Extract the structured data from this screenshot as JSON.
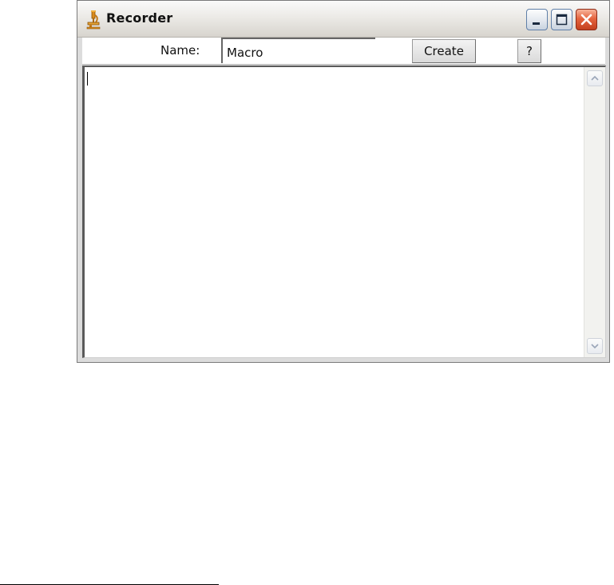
{
  "window": {
    "title": "Recorder",
    "app_icon": "microscope-icon",
    "controls": {
      "minimize_icon": "minimize-icon",
      "maximize_icon": "maximize-icon",
      "close_icon": "close-icon"
    }
  },
  "toolbar": {
    "name_label": "Name:",
    "name_value": "Macro",
    "create_label": "Create",
    "help_label": "?"
  },
  "editor": {
    "content": "",
    "scroll_up_icon": "chevron-up-icon",
    "scroll_down_icon": "chevron-down-icon"
  },
  "colors": {
    "close_button": "#d9522d",
    "title_bar": "#eceae6",
    "frame": "#dcdcdc"
  }
}
